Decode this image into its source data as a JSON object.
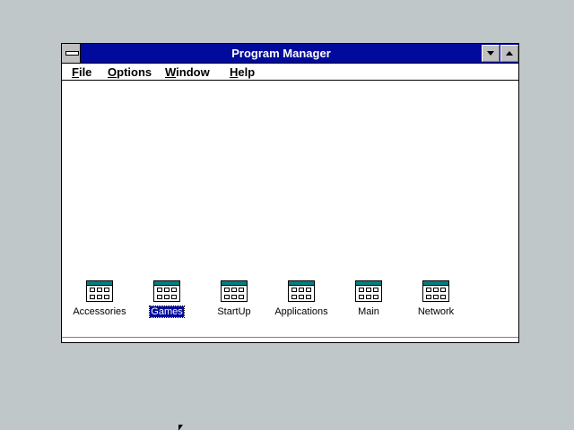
{
  "window": {
    "title": "Program Manager"
  },
  "menubar": {
    "items": [
      {
        "label": "File",
        "mnemonic": "F"
      },
      {
        "label": "Options",
        "mnemonic": "O"
      },
      {
        "label": "Window",
        "mnemonic": "W"
      },
      {
        "label": "Help",
        "mnemonic": "H"
      }
    ]
  },
  "groups": [
    {
      "label": "Accessories",
      "selected": false
    },
    {
      "label": "Games",
      "selected": true
    },
    {
      "label": "StartUp",
      "selected": false
    },
    {
      "label": "Applications",
      "selected": false
    },
    {
      "label": "Main",
      "selected": false
    },
    {
      "label": "Network",
      "selected": false
    }
  ],
  "colors": {
    "desktop": "#c0c7c8",
    "titlebar": "#000a9c",
    "selection": "#000a9c"
  }
}
